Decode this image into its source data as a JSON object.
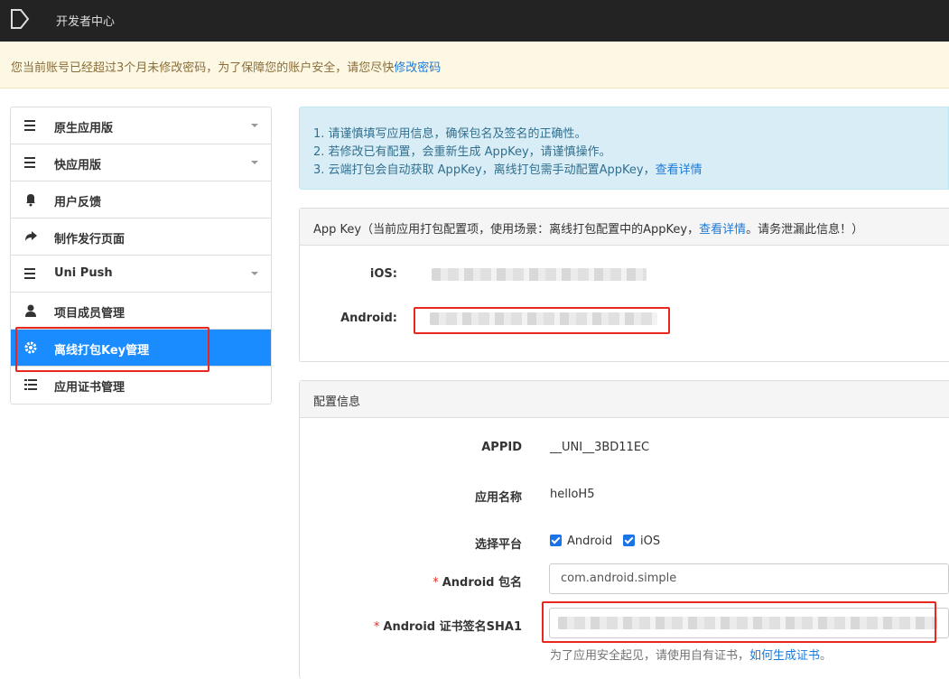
{
  "topbar": {
    "title": "开发者中心",
    "logo_icon": "play-logo-icon"
  },
  "warning": {
    "text": "您当前账号已经超过3个月未修改密码，为了保障您的账户安全，请您尽快",
    "link": "修改密码"
  },
  "sidebar": {
    "items": [
      {
        "label": "原生应用版",
        "icon": "menu-icon",
        "has_caret": true
      },
      {
        "label": "快应用版",
        "icon": "menu-icon",
        "has_caret": true
      },
      {
        "label": "用户反馈",
        "icon": "bell-icon",
        "has_caret": false
      },
      {
        "label": "制作发行页面",
        "icon": "share-arrow-icon",
        "has_caret": false
      },
      {
        "label": "Uni Push",
        "icon": "menu-icon",
        "has_caret": true
      },
      {
        "label": "项目成员管理",
        "icon": "user-icon",
        "has_caret": false
      },
      {
        "label": "离线打包Key管理",
        "icon": "gear-icon",
        "has_caret": false,
        "active": true
      },
      {
        "label": "应用证书管理",
        "icon": "list-icon",
        "has_caret": false
      }
    ]
  },
  "info": {
    "line1": "1. 请谨慎填写应用信息，确保包名及签名的正确性。",
    "line2": "2. 若修改已有配置，会重新生成 AppKey，请谨慎操作。",
    "line3": "3. 云端打包会自动获取 AppKey，离线打包需手动配置AppKey，",
    "line3_link": "查看详情"
  },
  "appkey_panel": {
    "header_pre": "App Key（当前应用打包配置项，使用场景：离线打包配置中的AppKey，",
    "header_link": "查看详情",
    "header_post": "。请务泄漏此信息！）",
    "ios_label": "iOS:",
    "android_label": "Android:"
  },
  "config_panel": {
    "header": "配置信息",
    "appid_label": "APPID",
    "appid_value": "__UNI__3BD11EC",
    "appname_label": "应用名称",
    "appname_value": "helloH5",
    "platform_label": "选择平台",
    "platform_android": "Android",
    "platform_ios": "iOS",
    "pkg_label": "Android 包名",
    "pkg_value": "com.android.simple",
    "sha1_label": "Android 证书签名SHA1",
    "help_text": "为了应用安全起见，请使用自有证书，",
    "help_link": "如何生成证书",
    "help_end": "。",
    "required_mark": "*"
  },
  "colors": {
    "accent": "#1a8cff",
    "highlight": "#e8281e",
    "link": "#1d7ad6"
  }
}
